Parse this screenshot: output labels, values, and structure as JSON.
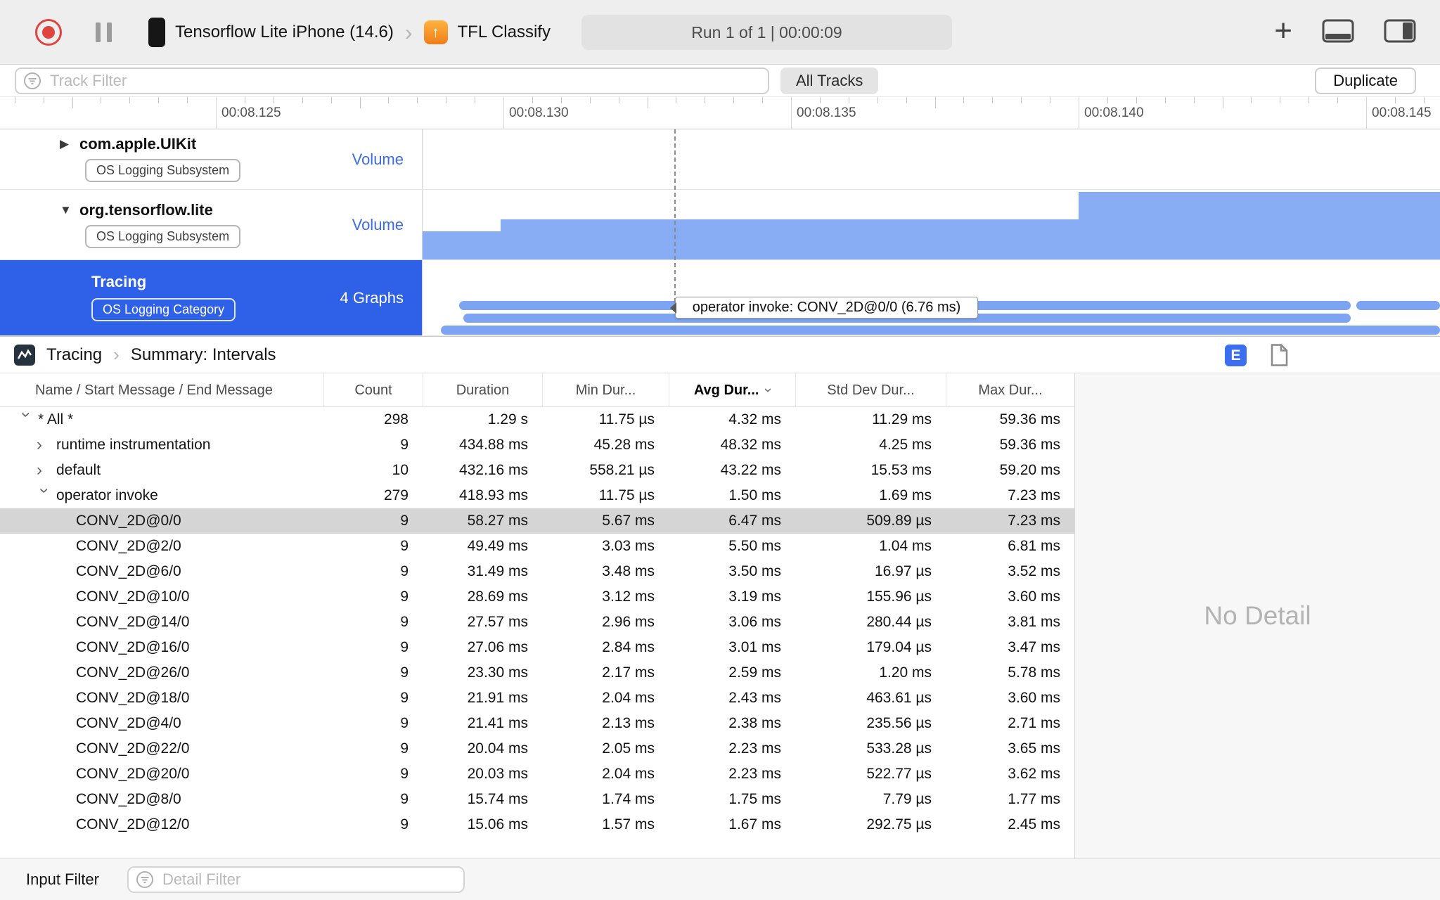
{
  "toolbar": {
    "device_name": "Tensorflow Lite iPhone (14.6)",
    "target_name": "TFL Classify",
    "run_status": "Run 1 of 1  |  00:00:09"
  },
  "filter_bar": {
    "track_filter_placeholder": "Track Filter",
    "all_tracks": "All Tracks",
    "duplicate": "Duplicate"
  },
  "ruler": {
    "labels": [
      "00:08.125",
      "00:08.130",
      "00:08.135",
      "00:08.140",
      "00:08.145"
    ]
  },
  "tracks": [
    {
      "name": "com.apple.UIKit",
      "badge": "OS Logging Subsystem",
      "meta": "Volume"
    },
    {
      "name": "org.tensorflow.lite",
      "badge": "OS Logging Subsystem",
      "meta": "Volume"
    },
    {
      "name": "Tracing",
      "badge": "OS Logging Category",
      "meta": "4 Graphs"
    }
  ],
  "timeline": {
    "tooltip": "operator invoke: CONV_2D@0/0 (6.76 ms)"
  },
  "detail_pane": {
    "breadcrumb_root": "Tracing",
    "breadcrumb_leaf": "Summary: Intervals",
    "e_badge": "E",
    "no_detail": "No Detail",
    "input_filter_label": "Input Filter",
    "detail_filter_placeholder": "Detail Filter"
  },
  "glyphs": {
    "chevron": "›",
    "plus": "+",
    "app_arrow": "↑",
    "disclosure_collapsed": "▶",
    "disclosure_expanded": "▼"
  },
  "table": {
    "columns": [
      {
        "label": "Name / Start Message / End Message"
      },
      {
        "label": "Count"
      },
      {
        "label": "Duration"
      },
      {
        "label": "Min Dur..."
      },
      {
        "label": "Avg Dur...",
        "sorted": true
      },
      {
        "label": "Std Dev Dur..."
      },
      {
        "label": "Max Dur..."
      }
    ],
    "rows": [
      {
        "name": "* All *",
        "level": 0,
        "expanded": true,
        "count": "298",
        "duration": "1.29 s",
        "min": "11.75 µs",
        "avg": "4.32 ms",
        "std": "11.29 ms",
        "max": "59.36 ms"
      },
      {
        "name": "runtime instrumentation",
        "level": 1,
        "expanded": false,
        "count": "9",
        "duration": "434.88 ms",
        "min": "45.28 ms",
        "avg": "48.32 ms",
        "std": "4.25 ms",
        "max": "59.36 ms"
      },
      {
        "name": "default",
        "level": 1,
        "expanded": false,
        "count": "10",
        "duration": "432.16 ms",
        "min": "558.21 µs",
        "avg": "43.22 ms",
        "std": "15.53 ms",
        "max": "59.20 ms"
      },
      {
        "name": "operator invoke",
        "level": 1,
        "expanded": true,
        "count": "279",
        "duration": "418.93 ms",
        "min": "11.75 µs",
        "avg": "1.50 ms",
        "std": "1.69 ms",
        "max": "7.23 ms"
      },
      {
        "name": "CONV_2D@0/0",
        "level": 2,
        "selected": true,
        "count": "9",
        "duration": "58.27 ms",
        "min": "5.67 ms",
        "avg": "6.47 ms",
        "std": "509.89 µs",
        "max": "7.23 ms"
      },
      {
        "name": "CONV_2D@2/0",
        "level": 2,
        "count": "9",
        "duration": "49.49 ms",
        "min": "3.03 ms",
        "avg": "5.50 ms",
        "std": "1.04 ms",
        "max": "6.81 ms"
      },
      {
        "name": "CONV_2D@6/0",
        "level": 2,
        "count": "9",
        "duration": "31.49 ms",
        "min": "3.48 ms",
        "avg": "3.50 ms",
        "std": "16.97 µs",
        "max": "3.52 ms"
      },
      {
        "name": "CONV_2D@10/0",
        "level": 2,
        "count": "9",
        "duration": "28.69 ms",
        "min": "3.12 ms",
        "avg": "3.19 ms",
        "std": "155.96 µs",
        "max": "3.60 ms"
      },
      {
        "name": "CONV_2D@14/0",
        "level": 2,
        "count": "9",
        "duration": "27.57 ms",
        "min": "2.96 ms",
        "avg": "3.06 ms",
        "std": "280.44 µs",
        "max": "3.81 ms"
      },
      {
        "name": "CONV_2D@16/0",
        "level": 2,
        "count": "9",
        "duration": "27.06 ms",
        "min": "2.84 ms",
        "avg": "3.01 ms",
        "std": "179.04 µs",
        "max": "3.47 ms"
      },
      {
        "name": "CONV_2D@26/0",
        "level": 2,
        "count": "9",
        "duration": "23.30 ms",
        "min": "2.17 ms",
        "avg": "2.59 ms",
        "std": "1.20 ms",
        "max": "5.78 ms"
      },
      {
        "name": "CONV_2D@18/0",
        "level": 2,
        "count": "9",
        "duration": "21.91 ms",
        "min": "2.04 ms",
        "avg": "2.43 ms",
        "std": "463.61 µs",
        "max": "3.60 ms"
      },
      {
        "name": "CONV_2D@4/0",
        "level": 2,
        "count": "9",
        "duration": "21.41 ms",
        "min": "2.13 ms",
        "avg": "2.38 ms",
        "std": "235.56 µs",
        "max": "2.71 ms"
      },
      {
        "name": "CONV_2D@22/0",
        "level": 2,
        "count": "9",
        "duration": "20.04 ms",
        "min": "2.05 ms",
        "avg": "2.23 ms",
        "std": "533.28 µs",
        "max": "3.65 ms"
      },
      {
        "name": "CONV_2D@20/0",
        "level": 2,
        "count": "9",
        "duration": "20.03 ms",
        "min": "2.04 ms",
        "avg": "2.23 ms",
        "std": "522.77 µs",
        "max": "3.62 ms"
      },
      {
        "name": "CONV_2D@8/0",
        "level": 2,
        "count": "9",
        "duration": "15.74 ms",
        "min": "1.74 ms",
        "avg": "1.75 ms",
        "std": "7.79 µs",
        "max": "1.77 ms"
      },
      {
        "name": "CONV_2D@12/0",
        "level": 2,
        "count": "9",
        "duration": "15.06 ms",
        "min": "1.57 ms",
        "avg": "1.67 ms",
        "std": "292.75 µs",
        "max": "2.45 ms"
      }
    ]
  }
}
